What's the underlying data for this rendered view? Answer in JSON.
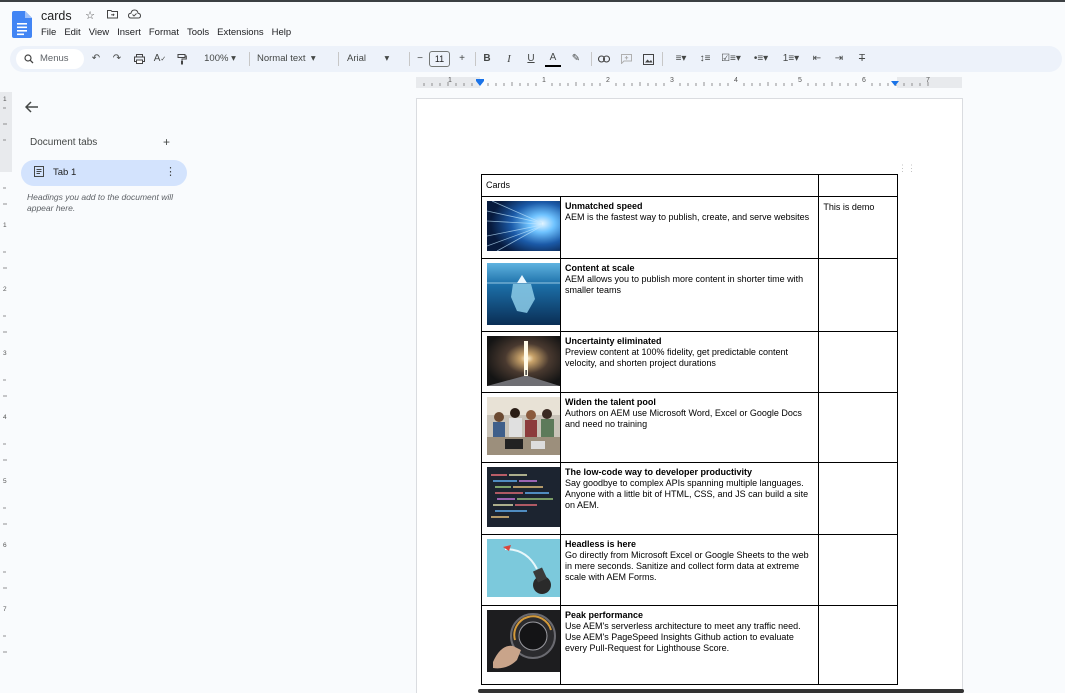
{
  "app": {
    "title": "cards",
    "menu": [
      "File",
      "Edit",
      "View",
      "Insert",
      "Format",
      "Tools",
      "Extensions",
      "Help"
    ]
  },
  "toolbar": {
    "search_label": "Menus",
    "zoom": "100%",
    "style": "Normal text",
    "font": "Arial",
    "font_size": "11"
  },
  "sidebar": {
    "section_title": "Document tabs",
    "tab_label": "Tab 1",
    "hint": "Headings you add to the document will appear here."
  },
  "ruler": {
    "labels": [
      "1",
      "1",
      "2",
      "3",
      "4",
      "5",
      "6",
      "7"
    ],
    "side_labels": [
      "1",
      "1",
      "2",
      "3",
      "4",
      "5",
      "6",
      "7"
    ]
  },
  "table": {
    "header": "Cards",
    "rows": [
      {
        "title": "Unmatched speed",
        "body": "AEM is the fastest way to publish, create, and serve websites",
        "extra": "This is demo",
        "image": "speed-lights-image"
      },
      {
        "title": "Content at scale",
        "body": "AEM allows you to publish more content in shorter time with smaller teams",
        "extra": "",
        "image": "iceberg-image"
      },
      {
        "title": "Uncertainty eliminated",
        "body": "Preview content at 100% fidelity, get predictable content velocity, and shorten project durations",
        "extra": "",
        "image": "light-door-image"
      },
      {
        "title": "Widen the talent pool",
        "body": "Authors on AEM use Microsoft Word, Excel or Google Docs and need no training",
        "extra": "",
        "image": "team-meeting-image"
      },
      {
        "title": "The low-code way to developer productivity",
        "body": "Say goodbye to complex APIs spanning multiple languages. Anyone with a little bit of HTML, CSS, and JS can build a site on AEM.",
        "extra": "",
        "image": "code-screen-image"
      },
      {
        "title": "Headless is here",
        "body": "Go directly from Microsoft Excel or Google Sheets to the web in mere seconds. Sanitize and collect form data at extreme scale with AEM Forms.",
        "extra": "",
        "image": "rocket-image"
      },
      {
        "title": "Peak performance",
        "body": "Use AEM's serverless architecture to meet any traffic need. Use AEM's PageSpeed Insights Github action to evaluate every Pull-Request for Lighthouse Score.",
        "extra": "",
        "image": "speedometer-image"
      }
    ]
  },
  "colors": {
    "accent": "#0b57d0",
    "toolbar_bg": "#edf2fa",
    "tab_active_bg": "#d3e3fd",
    "canvas_bg": "#f9fbfd"
  }
}
